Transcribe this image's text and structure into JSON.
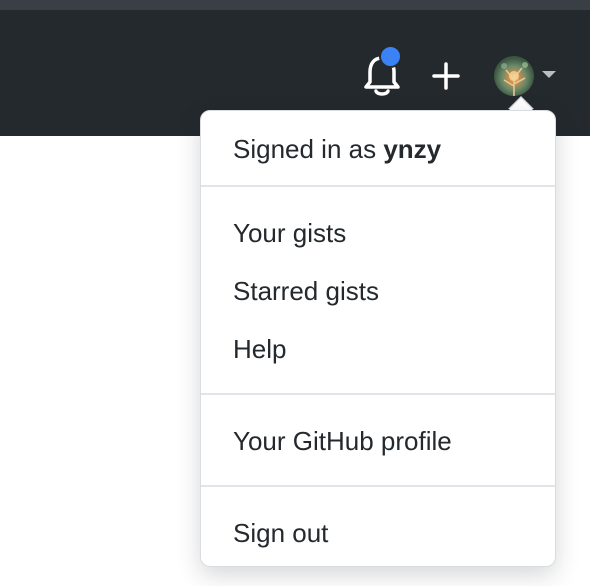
{
  "header": {
    "notification_color": "#3b82f6",
    "background": "#24292e"
  },
  "user_menu": {
    "signed_in_prefix": "Signed in as",
    "username": "ynzy",
    "items": [
      {
        "label": "Your gists"
      },
      {
        "label": "Starred gists"
      },
      {
        "label": "Help"
      },
      {
        "label": "Your GitHub profile"
      },
      {
        "label": "Sign out"
      }
    ]
  }
}
